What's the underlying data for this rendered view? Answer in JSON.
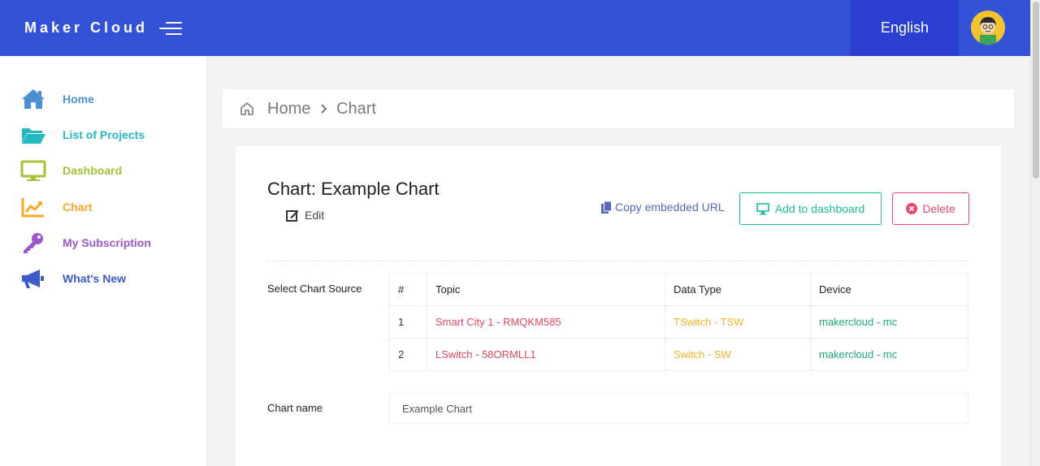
{
  "header": {
    "brand": "Maker Cloud",
    "language": "English"
  },
  "colors": {
    "topbar": "#3452d6",
    "language_bg": "#2a3fd2"
  },
  "sidebar": {
    "items": [
      {
        "label": "Home",
        "icon": "home-icon",
        "color": "#4a8fd0"
      },
      {
        "label": "List of Projects",
        "icon": "folder-open-icon",
        "color": "#26b8c0"
      },
      {
        "label": "Dashboard",
        "icon": "monitor-icon",
        "color": "#a6c23a"
      },
      {
        "label": "Chart",
        "icon": "chart-line-icon",
        "color": "#f7a829"
      },
      {
        "label": "My Subscription",
        "icon": "key-icon",
        "color": "#9a57c7"
      },
      {
        "label": "What's New",
        "icon": "megaphone-icon",
        "color": "#3d5bc8"
      }
    ]
  },
  "breadcrumb": {
    "home": "Home",
    "current": "Chart"
  },
  "chart": {
    "title": "Chart: Example Chart",
    "edit_label": "Edit",
    "copy_url_label": "Copy embedded URL",
    "add_dashboard_label": "Add to dashboard",
    "delete_label": "Delete"
  },
  "source": {
    "label": "Select Chart Source",
    "columns": [
      "#",
      "Topic",
      "Data Type",
      "Device"
    ],
    "rows": [
      {
        "num": "1",
        "topic": "Smart City 1 - RMQKM585",
        "type": "TSwitch - TSW",
        "device": "makercloud - mc"
      },
      {
        "num": "2",
        "topic": "LSwitch - 58ORMLL1",
        "type": "Switch - SW",
        "device": "makercloud - mc"
      }
    ]
  },
  "name_field": {
    "label": "Chart name",
    "value": "Example Chart"
  }
}
